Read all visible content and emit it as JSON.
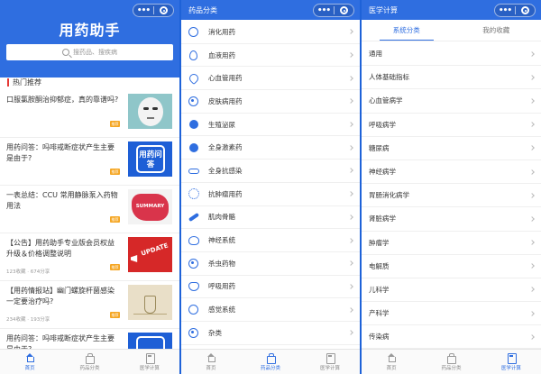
{
  "home": {
    "app_title": "用药助手",
    "search_placeholder": "搜药品、搜疾病",
    "section_title": "热门推荐",
    "articles": [
      {
        "title": "口服氯胺酮治抑郁症，真的靠谱吗?",
        "meta": "",
        "tag": "推荐",
        "thumb": "face-illustration"
      },
      {
        "title": "用药问答：吗啡戒断症状产生主要是由于?",
        "meta": "",
        "tag": "推荐",
        "thumb": "qa-badge",
        "thumb_text": "用药问答"
      },
      {
        "title": "一表总结：CCU 常用静脉泵入药物用法",
        "meta": "",
        "tag": "推荐",
        "thumb": "summary-blob",
        "thumb_text": "SUMMARY"
      },
      {
        "title": "【公告】用药助手专业版会员权益升级＆价格调整说明",
        "meta": "123收藏 · 674分享",
        "tag": "推荐",
        "thumb": "update-megaphone",
        "thumb_text": "UPDATE"
      },
      {
        "title": "【用药情报站】幽门螺旋杆菌感染一定要治疗吗?",
        "meta": "234收藏 · 193分享",
        "tag": "推荐",
        "thumb": "lab-flask"
      },
      {
        "title": "用药问答：吗啡戒断症状产生主要是由于?",
        "meta": "",
        "tag": "",
        "thumb": "qa-badge"
      }
    ]
  },
  "drug_category": {
    "title": "药品分类",
    "items": [
      {
        "label": "消化用药",
        "icon": "stomach-icon"
      },
      {
        "label": "血液用药",
        "icon": "blood-drop-icon"
      },
      {
        "label": "心血管用药",
        "icon": "heart-icon"
      },
      {
        "label": "皮肤病用药",
        "icon": "skin-icon"
      },
      {
        "label": "生殖泌尿",
        "icon": "reproductive-icon"
      },
      {
        "label": "全身激素药",
        "icon": "hormone-icon"
      },
      {
        "label": "全身抗感染",
        "icon": "anti-infection-icon"
      },
      {
        "label": "抗肿瘤用药",
        "icon": "tumor-icon"
      },
      {
        "label": "肌肉骨骼",
        "icon": "bone-icon"
      },
      {
        "label": "神经系统",
        "icon": "brain-icon"
      },
      {
        "label": "杀虫药物",
        "icon": "insecticide-icon"
      },
      {
        "label": "呼吸用药",
        "icon": "lungs-icon"
      },
      {
        "label": "感觉系统",
        "icon": "sensory-icon"
      },
      {
        "label": "杂类",
        "icon": "misc-icon"
      }
    ]
  },
  "medical_calc": {
    "title": "医学计算",
    "tabs": [
      "系统分类",
      "我的收藏"
    ],
    "active_tab": 0,
    "items": [
      "通用",
      "人体基础指标",
      "心血管病学",
      "呼吸病学",
      "糖尿病",
      "神经病学",
      "胃肠消化病学",
      "肾脏病学",
      "肿瘤学",
      "电解质",
      "儿科学",
      "产科学",
      "传染病"
    ]
  },
  "tabbar": {
    "items": [
      {
        "label": "首页",
        "icon": "home-icon"
      },
      {
        "label": "药品分类",
        "icon": "drug-bag-icon"
      },
      {
        "label": "医学计算",
        "icon": "calculator-icon"
      }
    ]
  },
  "colors": {
    "brand_blue": "#2f6ee0",
    "tag_orange": "#f5a623",
    "accent_red": "#e53935"
  }
}
